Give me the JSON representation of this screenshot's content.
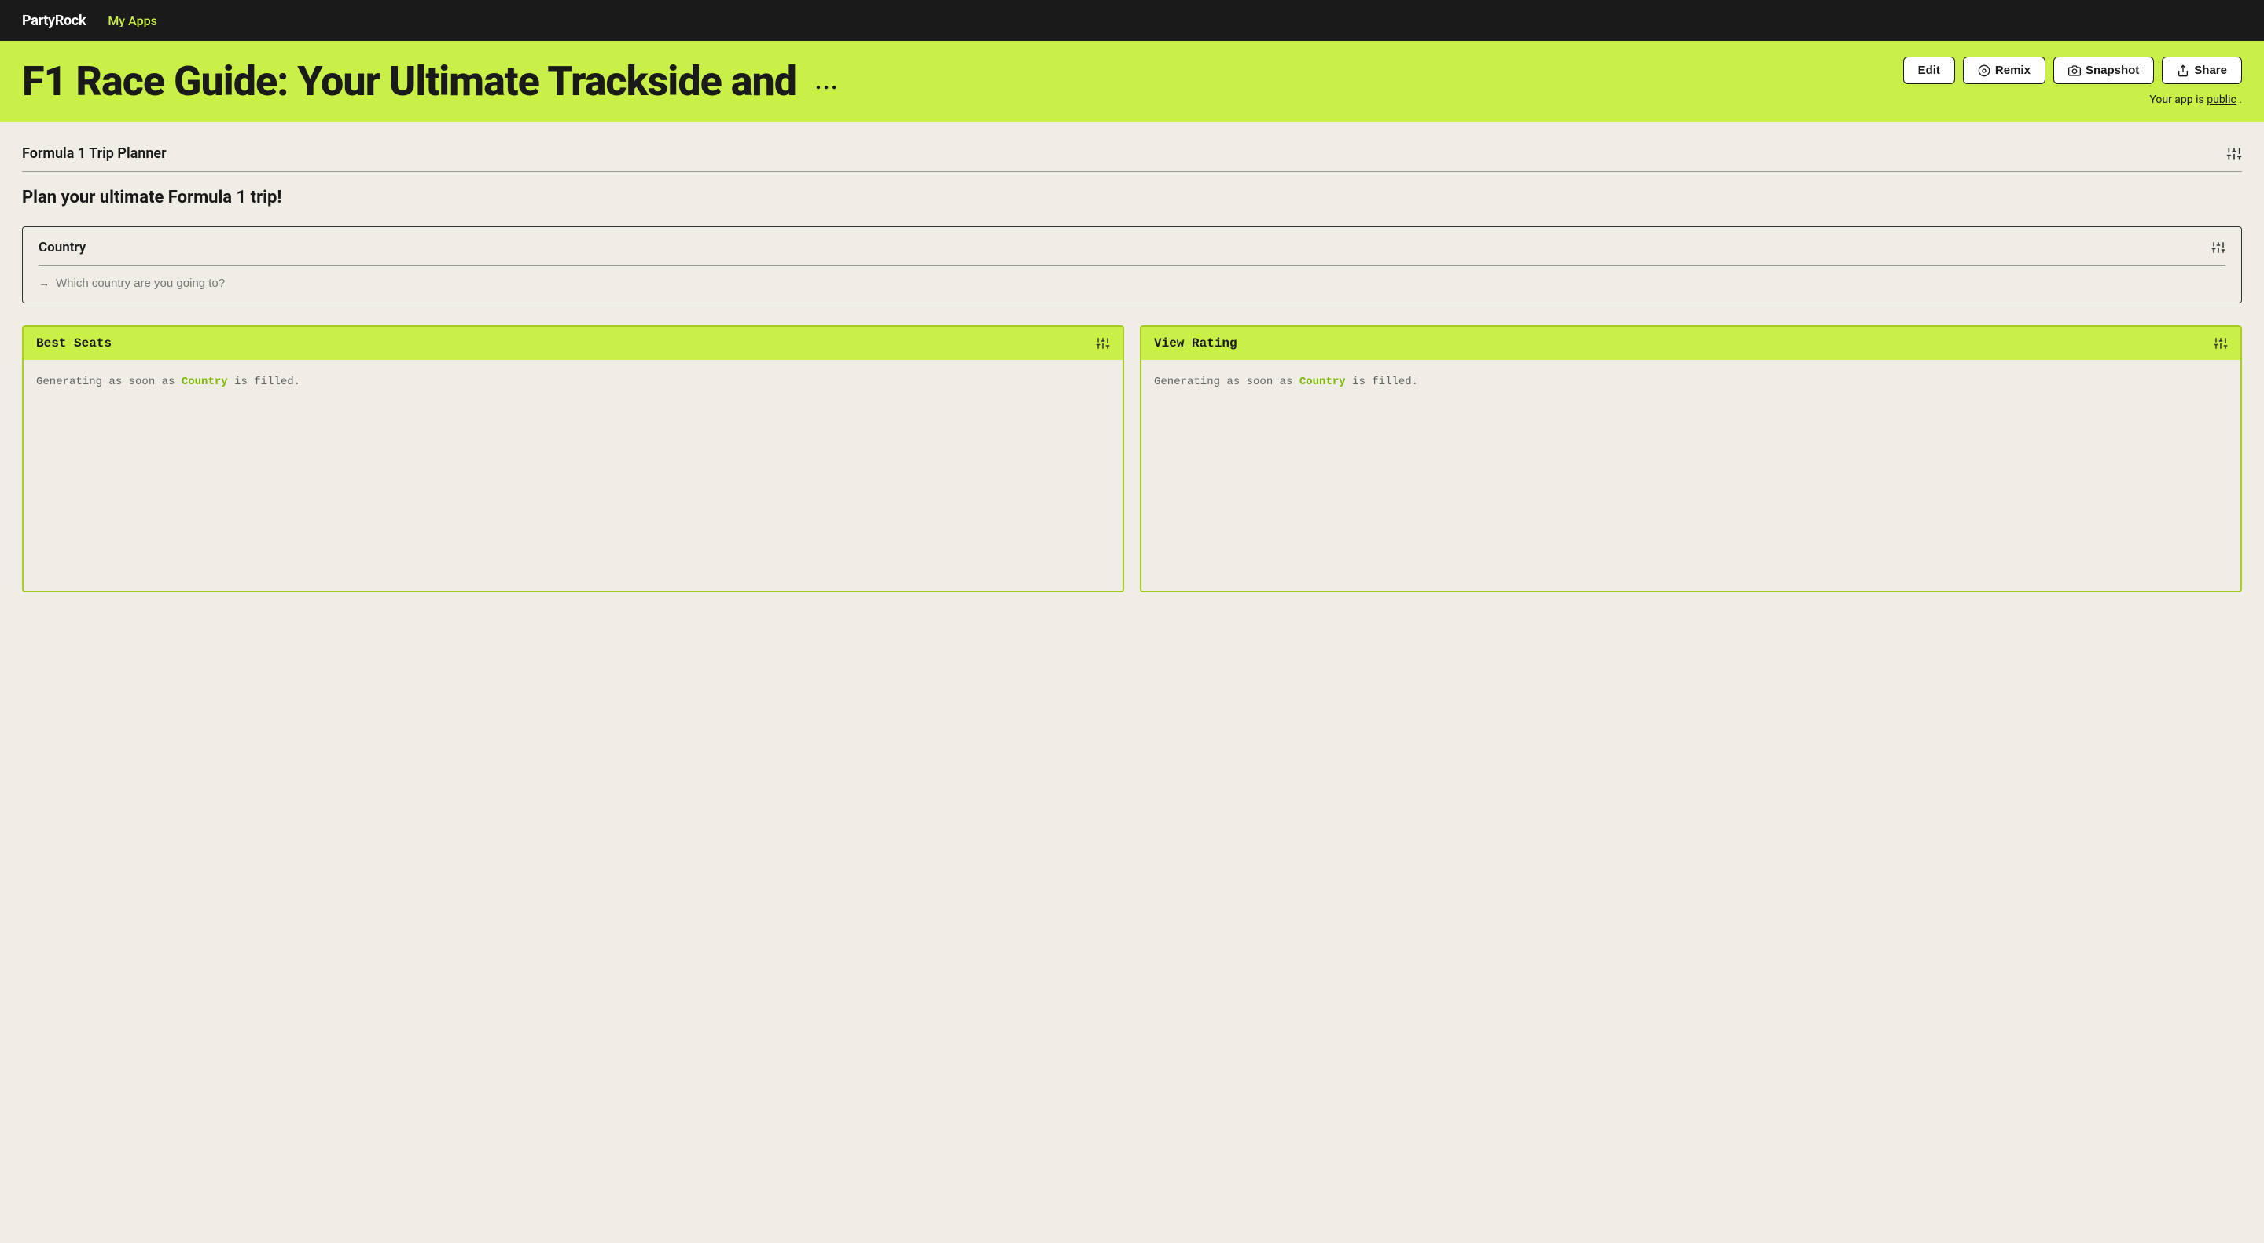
{
  "navbar": {
    "brand": "PartyRock",
    "link": "My Apps"
  },
  "header": {
    "title": "F1 Race Guide: Your Ultimate Trackside and",
    "more_dots": "...",
    "buttons": {
      "edit": "Edit",
      "remix": "Remix",
      "snapshot": "Snapshot",
      "share": "Share"
    },
    "public_text_prefix": "Your app is",
    "public_text_link": "public",
    "public_text_suffix": "."
  },
  "main": {
    "section_title": "Formula 1 Trip Planner",
    "subtitle": "Plan your ultimate Formula 1 trip!",
    "country_widget": {
      "label": "Country",
      "placeholder": "Which country are you going to?"
    },
    "panels": [
      {
        "title": "Best Seats",
        "generating_prefix": "Generating as soon as",
        "generating_highlight": "Country",
        "generating_suffix": "is filled."
      },
      {
        "title": "View Rating",
        "generating_prefix": "Generating as soon as",
        "generating_highlight": "Country",
        "generating_suffix": "is filled."
      }
    ]
  }
}
